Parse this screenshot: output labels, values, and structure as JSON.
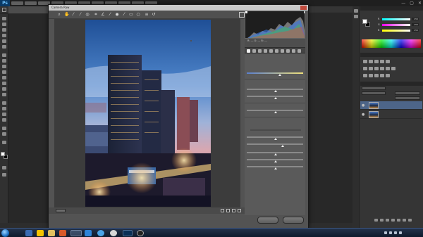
{
  "app": {
    "logo": "Ps"
  },
  "menu_bar": {
    "window_controls": [
      "—",
      "▢",
      "✕"
    ]
  },
  "document": {
    "status_zoom": ""
  },
  "camera_raw": {
    "title": "Camera Raw",
    "toolbar_icons": [
      "zoom-icon",
      "hand-icon",
      "white-balance-icon",
      "color-sampler-icon",
      "targeted-adjustment-icon",
      "crop-icon",
      "straighten-icon",
      "spot-removal-icon",
      "red-eye-icon",
      "adjustment-brush-icon",
      "graduated-filter-icon",
      "radial-filter-icon",
      "preferences-icon",
      "rotate-left-icon"
    ],
    "info": {
      "rgb": "R: --- G: --- B: ---",
      "meta": ""
    },
    "panel_tab_icons": [
      "basic-icon",
      "tone-curve-icon",
      "detail-icon",
      "hsl-icon",
      "split-toning-icon",
      "lens-icon",
      "effects-icon",
      "camera-calibration-icon",
      "presets-icon",
      "snapshots-icon"
    ],
    "panel": {
      "title": "",
      "section_1": "",
      "section_2": "",
      "section_3": ""
    },
    "buttons": {
      "ok": "",
      "cancel": ""
    },
    "bottom": {
      "zoom": ""
    }
  },
  "right_panels": {
    "tabs": {
      "color": "",
      "swatches": ""
    },
    "adjustments_tab": "",
    "layers_tab": "",
    "layer_kind": "",
    "blend_mode": "",
    "opacity": "",
    "fill": "",
    "layers": [
      {
        "name": ""
      },
      {
        "name": ""
      }
    ],
    "color_channels": [
      {
        "label": "R",
        "value": "255"
      },
      {
        "label": "G",
        "value": "255"
      },
      {
        "label": "B",
        "value": "255"
      }
    ]
  },
  "taskbar": {
    "clock_time": "",
    "clock_date": "",
    "apps": [
      "explorer",
      "qq",
      "browser",
      "media",
      "app",
      "photoshop",
      "app2"
    ]
  },
  "colors": {
    "accent": "#1a6fc2",
    "ps_blue": "#6fc3ff",
    "close_red": "#c14a3c"
  }
}
